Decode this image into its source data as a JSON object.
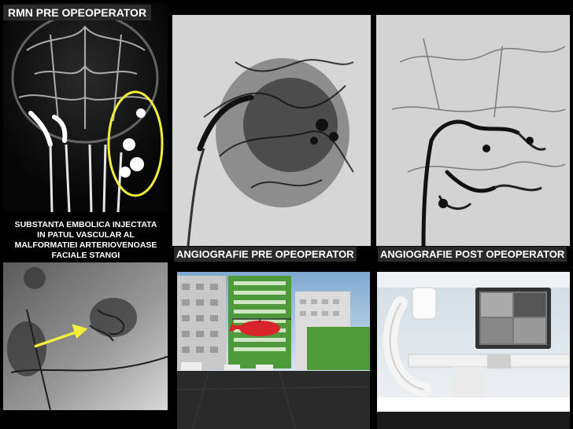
{
  "panels": {
    "mri": {
      "label": "RMN PRE OPEOPERATOR"
    },
    "angio_pre": {
      "label": "ANGIOGRAFIE PRE OPEOPERATOR"
    },
    "angio_post": {
      "label": "ANGIOGRAFIE POST OPEOPERATOR"
    },
    "embolic": {
      "caption_lines": [
        "SUBSTANTA EMBOLICA INJECTATA",
        "IN PATUL VASCULAR AL",
        "MALFORMATIEI ARTERIOVENOASE",
        "FACIALE STANGI"
      ]
    }
  },
  "colors": {
    "background": "#000000",
    "highlight": "#f2ee3a",
    "helicopter": "#d8242a",
    "building_green": "#4e9a3a"
  }
}
